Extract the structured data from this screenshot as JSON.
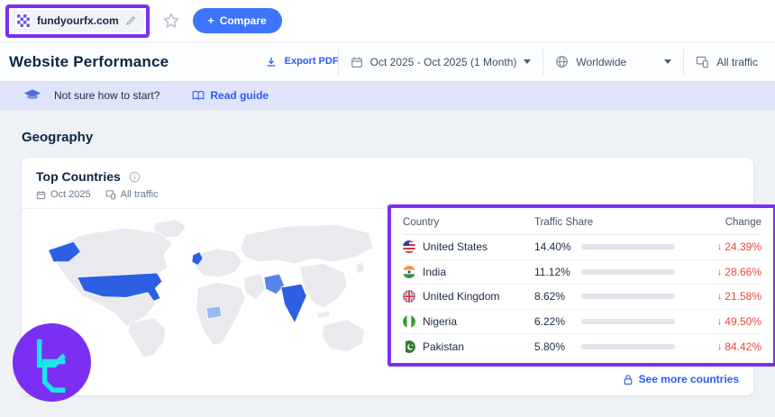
{
  "topbar": {
    "domain": "fundyourfx.com",
    "compare_label": "Compare",
    "compare_plus": "+"
  },
  "header": {
    "title": "Website Performance",
    "export_label": "Export PDF",
    "date_range": "Oct 2025 - Oct 2025 (1 Month)",
    "region": "Worldwide",
    "traffic_label": "All traffic"
  },
  "banner": {
    "text": "Not sure how to start?",
    "link_label": "Read guide"
  },
  "section_title": "Geography",
  "card": {
    "title": "Top Countries",
    "date_label": "Oct 2025",
    "traffic_label": "All traffic",
    "see_more_label": "See more countries"
  },
  "table": {
    "columns": [
      "Country",
      "Traffic Share",
      "Change"
    ],
    "rows": [
      {
        "country": "United States",
        "flag": "us",
        "share": "14.40%",
        "share_value": 14.4,
        "change": "24.39%",
        "direction": "down"
      },
      {
        "country": "India",
        "flag": "in",
        "share": "11.12%",
        "share_value": 11.12,
        "change": "28.66%",
        "direction": "down"
      },
      {
        "country": "United Kingdom",
        "flag": "gb",
        "share": "8.62%",
        "share_value": 8.62,
        "change": "21.58%",
        "direction": "down"
      },
      {
        "country": "Nigeria",
        "flag": "ng",
        "share": "6.22%",
        "share_value": 6.22,
        "change": "49.50%",
        "direction": "down"
      },
      {
        "country": "Pakistan",
        "flag": "pk",
        "share": "5.80%",
        "share_value": 5.8,
        "change": "84.42%",
        "direction": "down"
      }
    ]
  },
  "map": {
    "highlighted_countries": [
      "United States",
      "United Kingdom",
      "India",
      "Nigeria",
      "Pakistan"
    ]
  },
  "colors": {
    "accent_blue": "#3e74fe",
    "bar_fill": "#2d63e8",
    "negative_red": "#e5483c",
    "annotation_purple": "#7b2ff2",
    "banner_bg": "#dfe4fa"
  }
}
